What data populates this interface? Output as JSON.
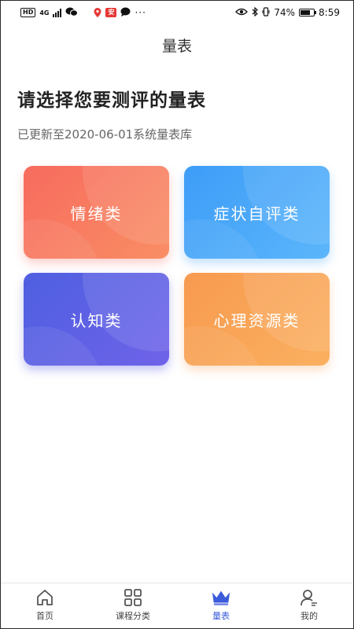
{
  "status_bar": {
    "network_chip": "HD",
    "network_type": "4G",
    "battery_percent": "74%",
    "battery_level": 0.74,
    "time": "8:59",
    "app_icon_label": "安"
  },
  "nav": {
    "title": "量表"
  },
  "main": {
    "heading": "请选择您要测评的量表",
    "subtitle": "已更新至2020-06-01系统量表库",
    "cards": [
      {
        "label": "情绪类",
        "color_start": "#f76b5e",
        "color_end": "#f98e64"
      },
      {
        "label": "症状自评类",
        "color_start": "#3d9cf7",
        "color_end": "#5bb6fb"
      },
      {
        "label": "认知类",
        "color_start": "#4e5fe0",
        "color_end": "#6f63e9"
      },
      {
        "label": "心理资源类",
        "color_start": "#f79a4f",
        "color_end": "#fbb060"
      }
    ]
  },
  "tab_bar": {
    "active_color": "#3b5bdb",
    "items": [
      {
        "label": "首页",
        "icon": "home-icon"
      },
      {
        "label": "课程分类",
        "icon": "grid-icon"
      },
      {
        "label": "量表",
        "icon": "crown-icon",
        "active": true
      },
      {
        "label": "我的",
        "icon": "user-icon"
      }
    ]
  }
}
